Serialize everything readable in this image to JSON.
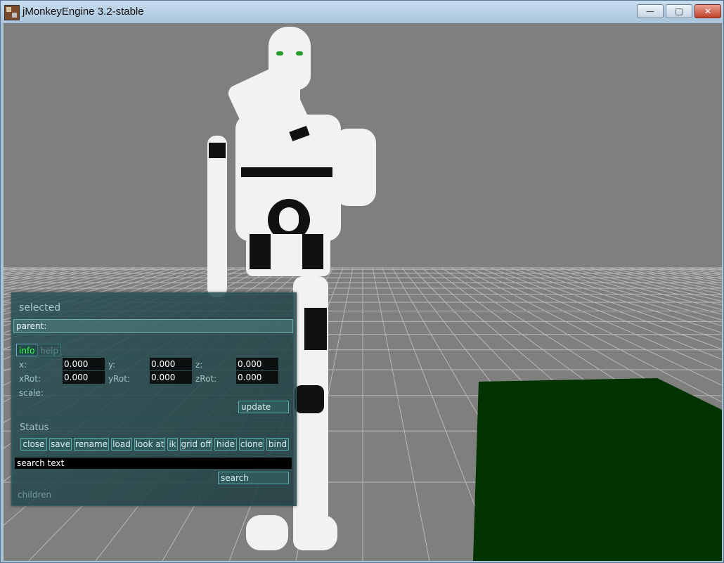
{
  "window": {
    "title": "jMonkeyEngine 3.2-stable",
    "controls": {
      "minimize": "—",
      "maximize": "□",
      "close": "✕"
    }
  },
  "panel": {
    "title": "selected",
    "parent_label": "parent:",
    "tabs": [
      {
        "label": "info",
        "active": true
      },
      {
        "label": "help",
        "active": false
      }
    ],
    "fields": {
      "x": {
        "label": "x:",
        "value": "0.000"
      },
      "y": {
        "label": "y:",
        "value": "0.000"
      },
      "z": {
        "label": "z:",
        "value": "0.000"
      },
      "xRot": {
        "label": "xRot:",
        "value": "0.000"
      },
      "yRot": {
        "label": "yRot:",
        "value": "0.000"
      },
      "zRot": {
        "label": "zRot:",
        "value": "0.000"
      },
      "scale": {
        "label": "scale:"
      }
    },
    "update_label": "update",
    "status_label": "Status",
    "buttons": [
      "close",
      "save",
      "rename",
      "load",
      "look at",
      "ik",
      "grid off",
      "hide",
      "clone",
      "bind"
    ],
    "search_text": "search text",
    "search_label": "search",
    "children_label": "children"
  },
  "colors": {
    "viewport_bg": "#7f7f7d",
    "active_tab": "#33ff44",
    "green_block": "#003300"
  }
}
